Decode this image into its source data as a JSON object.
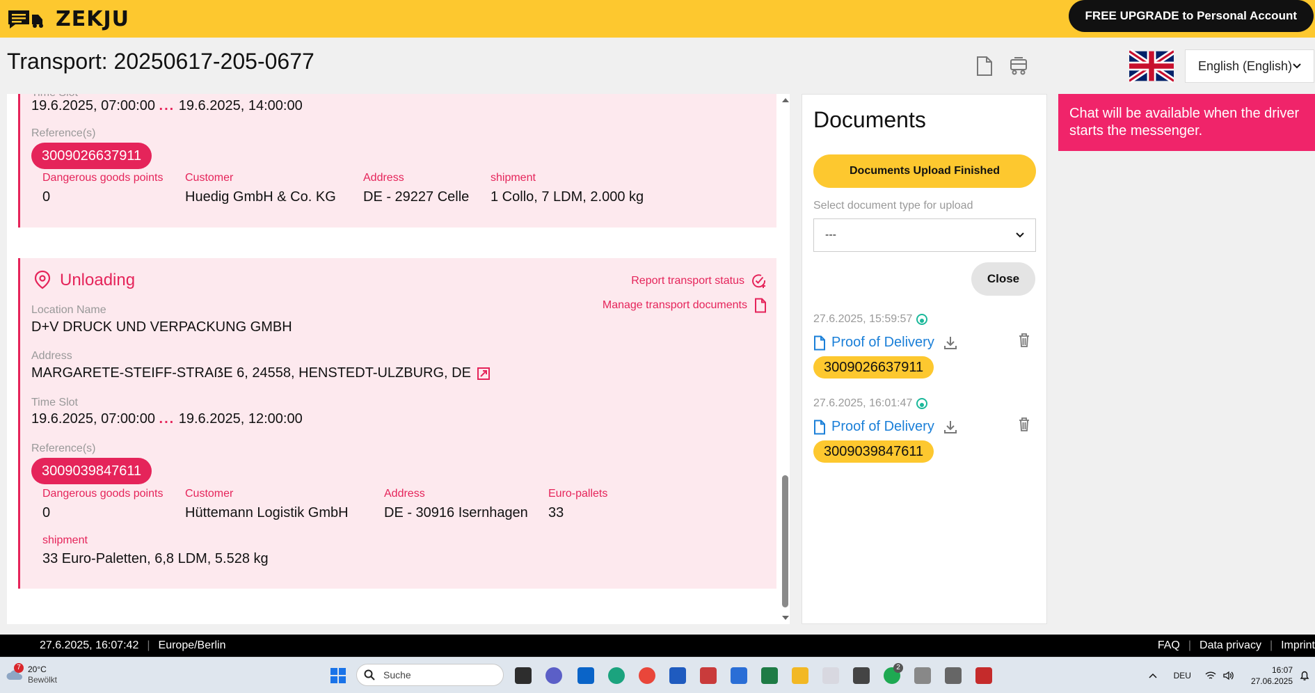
{
  "header": {
    "brand": "ZEKJU",
    "upgrade_label": "FREE UPGRADE to Personal Account"
  },
  "title": "Transport: 20250617-205-0677",
  "language": {
    "selected": "English (English)"
  },
  "loading": {
    "time_slot_label": "Time Slot",
    "time_from": "19.6.2025, 07:00:00",
    "dots": "...",
    "time_to": "19.6.2025, 14:00:00",
    "references_label": "Reference(s)",
    "reference": "3009026637911",
    "details": [
      {
        "label": "Dangerous goods points",
        "value": "0"
      },
      {
        "label": "Customer",
        "value": "Huedig GmbH & Co. KG"
      },
      {
        "label": "Address",
        "value": "DE - 29227 Celle"
      },
      {
        "label": "shipment",
        "value": "1 Collo, 7 LDM, 2.000 kg"
      }
    ]
  },
  "unloading": {
    "title": "Unloading",
    "report_status": "Report transport status",
    "manage_docs": "Manage transport documents",
    "location_label": "Location Name",
    "location": "D+V DRUCK UND VERPACKUNG GMBH",
    "address_label": "Address",
    "address": "MARGARETE-STEIFF-STRAẞE 6, 24558, HENSTEDT-ULZBURG, DE",
    "time_slot_label": "Time Slot",
    "time_from": "19.6.2025, 07:00:00",
    "dots": "...",
    "time_to": "19.6.2025, 12:00:00",
    "references_label": "Reference(s)",
    "reference": "3009039847611",
    "details": [
      {
        "label": "Dangerous goods points",
        "value": "0"
      },
      {
        "label": "Customer",
        "value": "Hüttemann Logistik GmbH"
      },
      {
        "label": "Address",
        "value": "DE - 30916 Isernhagen"
      },
      {
        "label": "Euro-pallets",
        "value": "33"
      },
      {
        "label": "shipment",
        "value": "33 Euro-Paletten, 6,8 LDM, 5.528 kg"
      }
    ]
  },
  "documents": {
    "title": "Documents",
    "upload_finished": "Documents Upload Finished",
    "type_label": "Select document type for upload",
    "type_selected": "---",
    "close_label": "Close",
    "items": [
      {
        "time": "27.6.2025, 15:59:57",
        "name": "Proof of Delivery",
        "reference": "3009026637911"
      },
      {
        "time": "27.6.2025, 16:01:47",
        "name": "Proof of Delivery",
        "reference": "3009039847611"
      }
    ]
  },
  "chat_notice": "Chat will be available when the driver starts the messenger.",
  "footer": {
    "datetime": "27.6.2025, 16:07:42",
    "sep": "|",
    "timezone": "Europe/Berlin",
    "links": [
      "FAQ",
      "Data privacy",
      "Imprint"
    ]
  },
  "taskbar": {
    "weather_badge": "7",
    "temperature": "20°C",
    "weather": "Bewölkt",
    "search_placeholder": "Suche",
    "whatsapp_badge": "2",
    "lang": "DEU",
    "time": "16:07",
    "date": "27.06.2025"
  },
  "colors": {
    "brand_yellow": "#fdc82f",
    "accent_pink": "#e5245a",
    "link_blue": "#1a7fd8"
  }
}
